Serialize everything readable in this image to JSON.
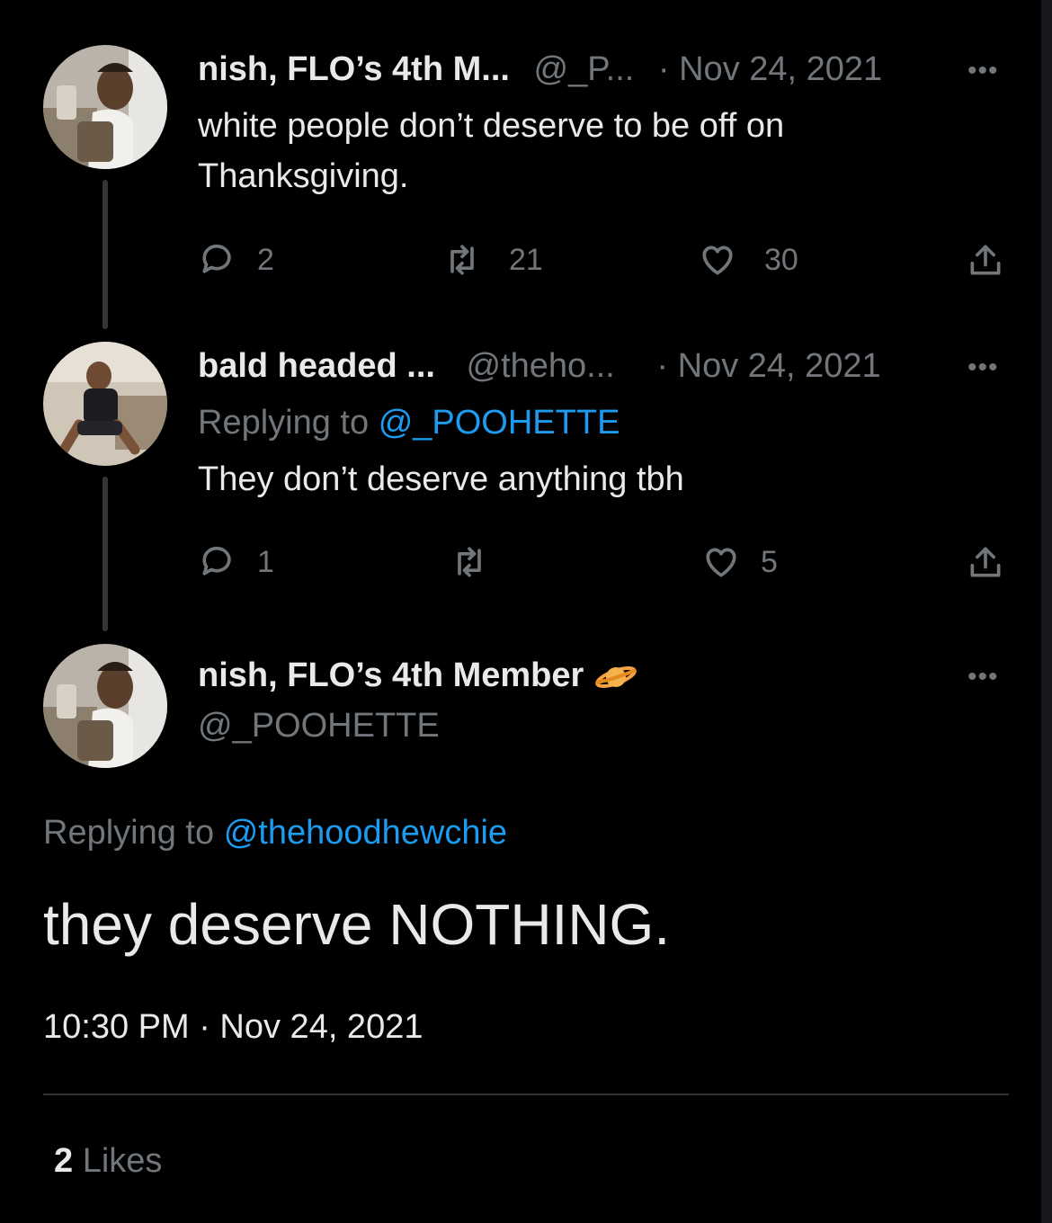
{
  "tweets": [
    {
      "name": "nish, FLO’s 4th M...",
      "handle": "@_P...",
      "date": "· Nov 24, 2021",
      "text_line1": "white people don’t deserve to be off on",
      "text_line2": "Thanksgiving.",
      "replies": "2",
      "retweets": "21",
      "likes": "30"
    },
    {
      "name": "bald headed ...",
      "handle": "@theho...",
      "date": "· Nov 24, 2021",
      "replying_prefix": "Replying to",
      "replying_handle": "@_POOHETTE",
      "text": "They don’t deserve anything tbh",
      "replies": "1",
      "retweets": "",
      "likes": "5"
    }
  ],
  "main": {
    "name": "nish, FLO’s 4th Member",
    "badge_icon": "ringed-planet-emoji",
    "handle": "@_POOHETTE",
    "replying_prefix": "Replying to",
    "replying_handle": "@thehoodhewchie",
    "text": "they deserve NOTHING.",
    "timestamp": "10:30 PM · Nov 24, 2021",
    "likes_count": "2",
    "likes_label": "Likes"
  },
  "more_label": "•••",
  "icons": [
    "reply-icon",
    "retweet-icon",
    "like-icon",
    "share-icon",
    "more-icon"
  ],
  "colors": {
    "background": "#000000",
    "text": "#e7e9ea",
    "secondary": "#71767b",
    "link": "#1d9bf0"
  }
}
